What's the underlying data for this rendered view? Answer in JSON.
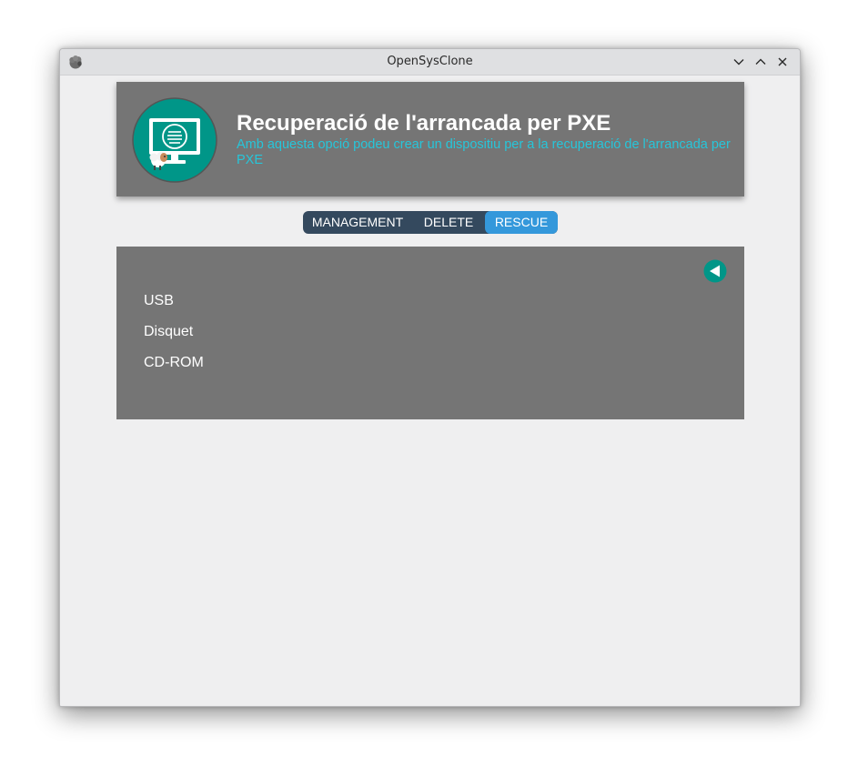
{
  "window": {
    "title": "OpenSysClone"
  },
  "colors": {
    "header_bg": "#757575",
    "subtitle": "#26c6da",
    "tabs_bg": "#34495e",
    "tab_active": "#3498db",
    "logo_circle": "#009688"
  },
  "icons": {
    "app": "sheep-icon",
    "minimize": "chevron-down-icon",
    "maximize": "chevron-up-icon",
    "close": "close-icon",
    "header": "monitor-icon",
    "back": "back-arrow-icon"
  },
  "header": {
    "title": "Recuperació de l'arrancada per PXE",
    "subtitle": "Amb aquesta opció podeu crear un dispositiu per a la recuperació de l'arrancada per PXE"
  },
  "tabs": [
    {
      "label": "MANAGEMENT",
      "active": false
    },
    {
      "label": "DELETE",
      "active": false
    },
    {
      "label": "RESCUE",
      "active": true
    }
  ],
  "rescue": {
    "options": [
      {
        "label": "USB"
      },
      {
        "label": "Disquet"
      },
      {
        "label": "CD-ROM"
      }
    ]
  }
}
